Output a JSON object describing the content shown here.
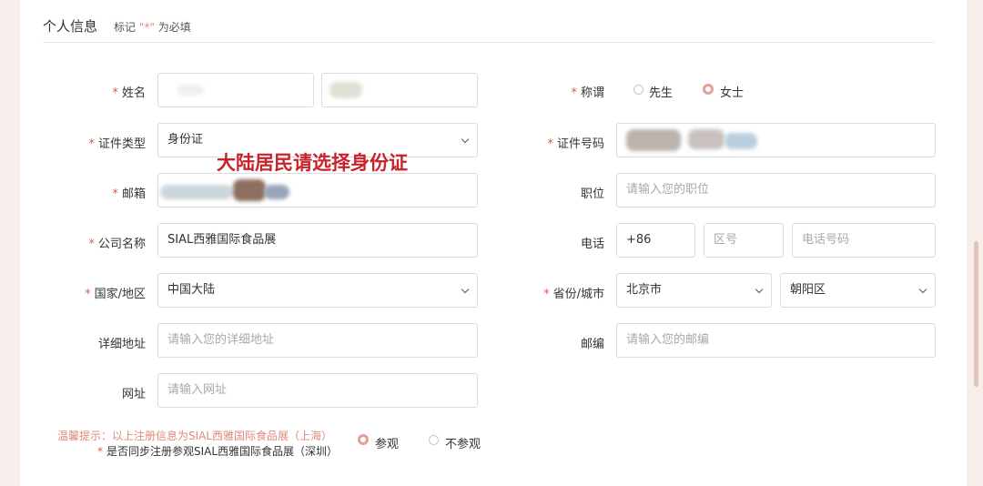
{
  "section": {
    "title": "个人信息",
    "note_prefix": "标记",
    "note_star": "\"*\"",
    "note_suffix": "为必填"
  },
  "fields": {
    "name": {
      "required": "*",
      "label": "姓名"
    },
    "salutation": {
      "required": "*",
      "label": "称谓",
      "options": [
        "先生",
        "女士"
      ],
      "selected": "女士"
    },
    "id_type": {
      "required": "*",
      "label": "证件类型",
      "value": "身份证"
    },
    "id_number": {
      "required": "*",
      "label": "证件号码"
    },
    "email": {
      "required": "*",
      "label": "邮箱"
    },
    "position": {
      "label": "职位",
      "placeholder": "请输入您的职位"
    },
    "company": {
      "required": "*",
      "label": "公司名称",
      "value": "SIAL西雅国际食品展"
    },
    "phone": {
      "label": "电话",
      "country_code": "+86",
      "area_placeholder": "区号",
      "number_placeholder": "电话号码"
    },
    "country": {
      "required": "*",
      "label": "国家/地区",
      "value": "中国大陆"
    },
    "province_city": {
      "required": "*",
      "label": "省份/城市",
      "province": "北京市",
      "city": "朝阳区"
    },
    "address": {
      "label": "详细地址",
      "placeholder": "请输入您的详细地址"
    },
    "postcode": {
      "label": "邮编",
      "placeholder": "请输入您的邮编"
    },
    "website": {
      "label": "网址",
      "placeholder": "请输入网址"
    }
  },
  "sync": {
    "hint": "温馨提示：以上注册信息为SIAL西雅国际食品展（上海）",
    "required": "*",
    "label": "是否同步注册参观SIAL西雅国际食品展（深圳）",
    "options": [
      "参观",
      "不参观"
    ],
    "selected": "参观"
  },
  "overlay_note": "大陆居民请选择身份证",
  "colors": {
    "required": "#e2564a",
    "accent": "#e2a196",
    "annotation": "#c8232a"
  }
}
